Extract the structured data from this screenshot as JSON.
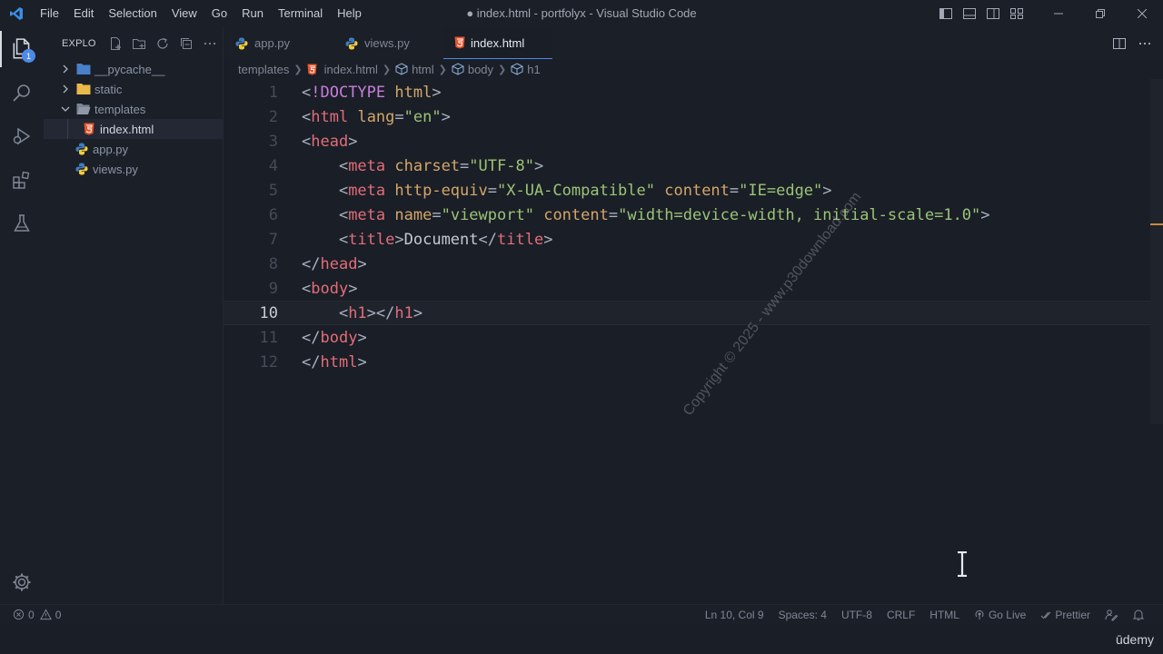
{
  "titlebar": {
    "menu": [
      "File",
      "Edit",
      "Selection",
      "View",
      "Go",
      "Run",
      "Terminal",
      "Help"
    ],
    "window_title": "● index.html - portfolyx - Visual Studio Code"
  },
  "activity": {
    "explorer_badge": "1"
  },
  "sidebar": {
    "title": "EXPLORER",
    "tree": [
      {
        "label": "__pycache__",
        "type": "folder",
        "expanded": false
      },
      {
        "label": "static",
        "type": "folder",
        "expanded": false
      },
      {
        "label": "templates",
        "type": "folder",
        "expanded": true
      },
      {
        "label": "index.html",
        "type": "html"
      },
      {
        "label": "app.py",
        "type": "python"
      },
      {
        "label": "views.py",
        "type": "python"
      }
    ]
  },
  "tabs": [
    {
      "label": "app.py",
      "icon": "python-icon"
    },
    {
      "label": "views.py",
      "icon": "python-icon"
    },
    {
      "label": "index.html",
      "icon": "html5-icon",
      "active": true,
      "dirty": true
    }
  ],
  "breadcrumbs": [
    "templates",
    "index.html",
    "html",
    "body",
    "h1"
  ],
  "editor": {
    "lines": [
      {
        "no": "1",
        "parts": [
          [
            "t-br",
            "<"
          ],
          [
            "t-kw",
            "!DOCTYPE"
          ],
          [
            "t-br",
            " "
          ],
          [
            "t-attr",
            "html"
          ],
          [
            "t-br",
            ">"
          ]
        ]
      },
      {
        "no": "2",
        "parts": [
          [
            "t-br",
            "<"
          ],
          [
            "t-tag",
            "html"
          ],
          [
            "t-br",
            " "
          ],
          [
            "t-attr",
            "lang"
          ],
          [
            "t-br",
            "="
          ],
          [
            "t-str",
            "\"en\""
          ],
          [
            "t-br",
            ">"
          ]
        ]
      },
      {
        "no": "3",
        "parts": [
          [
            "t-br",
            "<"
          ],
          [
            "t-tag",
            "head"
          ],
          [
            "t-br",
            ">"
          ]
        ]
      },
      {
        "no": "4",
        "parts": [
          [
            "t-br",
            "    <"
          ],
          [
            "t-tag",
            "meta"
          ],
          [
            "t-br",
            " "
          ],
          [
            "t-attr",
            "charset"
          ],
          [
            "t-br",
            "="
          ],
          [
            "t-str",
            "\"UTF-8\""
          ],
          [
            "t-br",
            ">"
          ]
        ]
      },
      {
        "no": "5",
        "parts": [
          [
            "t-br",
            "    <"
          ],
          [
            "t-tag",
            "meta"
          ],
          [
            "t-br",
            " "
          ],
          [
            "t-attr",
            "http-equiv"
          ],
          [
            "t-br",
            "="
          ],
          [
            "t-str",
            "\"X-UA-Compatible\""
          ],
          [
            "t-br",
            " "
          ],
          [
            "t-attr",
            "content"
          ],
          [
            "t-br",
            "="
          ],
          [
            "t-str",
            "\"IE=edge\""
          ],
          [
            "t-br",
            ">"
          ]
        ]
      },
      {
        "no": "6",
        "parts": [
          [
            "t-br",
            "    <"
          ],
          [
            "t-tag",
            "meta"
          ],
          [
            "t-br",
            " "
          ],
          [
            "t-attr",
            "name"
          ],
          [
            "t-br",
            "="
          ],
          [
            "t-str",
            "\"viewport\""
          ],
          [
            "t-br",
            " "
          ],
          [
            "t-attr",
            "content"
          ],
          [
            "t-br",
            "="
          ],
          [
            "t-str",
            "\"width=device-width, initial-scale=1.0\""
          ],
          [
            "t-br",
            ">"
          ]
        ]
      },
      {
        "no": "7",
        "parts": [
          [
            "t-br",
            "    <"
          ],
          [
            "t-tag",
            "title"
          ],
          [
            "t-br",
            ">"
          ],
          [
            "t-text",
            "Document"
          ],
          [
            "t-br",
            "</"
          ],
          [
            "t-tag",
            "title"
          ],
          [
            "t-br",
            ">"
          ]
        ]
      },
      {
        "no": "8",
        "parts": [
          [
            "t-br",
            "</"
          ],
          [
            "t-tag",
            "head"
          ],
          [
            "t-br",
            ">"
          ]
        ]
      },
      {
        "no": "9",
        "parts": [
          [
            "t-br",
            "<"
          ],
          [
            "t-tag",
            "body"
          ],
          [
            "t-br",
            ">"
          ]
        ]
      },
      {
        "no": "10",
        "current": true,
        "parts": [
          [
            "t-br",
            "    <"
          ],
          [
            "t-tag",
            "h1"
          ],
          [
            "t-br",
            "></"
          ],
          [
            "t-tag",
            "h1"
          ],
          [
            "t-br",
            ">"
          ]
        ]
      },
      {
        "no": "11",
        "parts": [
          [
            "t-br",
            "</"
          ],
          [
            "t-tag",
            "body"
          ],
          [
            "t-br",
            ">"
          ]
        ]
      },
      {
        "no": "12",
        "parts": [
          [
            "t-br",
            "</"
          ],
          [
            "t-tag",
            "html"
          ],
          [
            "t-br",
            ">"
          ]
        ]
      }
    ],
    "watermark": "Copyright © 2025 - www.p30download.com"
  },
  "status": {
    "errors": "0",
    "warnings": "0",
    "position": "Ln 10, Col 9",
    "spaces": "Spaces: 4",
    "encoding": "UTF-8",
    "eol": "CRLF",
    "language": "HTML",
    "golive": "Go Live",
    "prettier": "Prettier"
  },
  "brand": "ūdemy",
  "colors": {
    "background": "#1a1e26",
    "accent": "#4d8ae8",
    "tag": "#e26d79",
    "attribute": "#d3a66a",
    "string": "#9bc378"
  }
}
